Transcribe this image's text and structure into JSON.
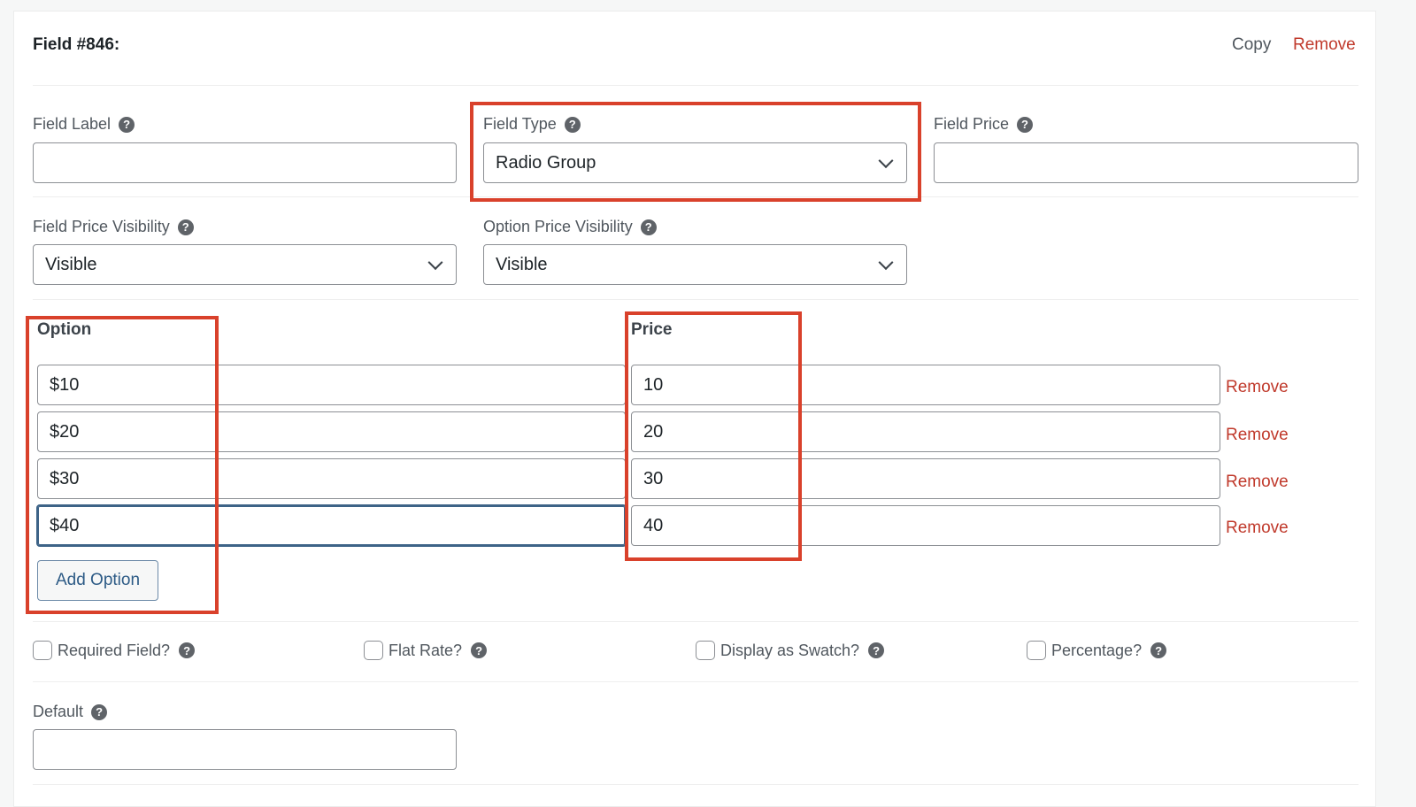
{
  "header": {
    "title": "Field #846:",
    "copy_label": "Copy",
    "remove_label": "Remove"
  },
  "fields": {
    "field_label": {
      "label": "Field Label",
      "value": ""
    },
    "field_type": {
      "label": "Field Type",
      "value": "Radio Group"
    },
    "field_price": {
      "label": "Field Price",
      "value": ""
    },
    "field_price_visibility": {
      "label": "Field Price Visibility",
      "value": "Visible"
    },
    "option_price_visibility": {
      "label": "Option Price Visibility",
      "value": "Visible"
    }
  },
  "options": {
    "option_header": "Option",
    "price_header": "Price",
    "rows": [
      {
        "option": "$10",
        "price": "10",
        "remove_label": "Remove"
      },
      {
        "option": "$20",
        "price": "20",
        "remove_label": "Remove"
      },
      {
        "option": "$30",
        "price": "30",
        "remove_label": "Remove"
      },
      {
        "option": "$40",
        "price": "40",
        "remove_label": "Remove"
      }
    ],
    "add_option_label": "Add Option"
  },
  "checkboxes": [
    {
      "label": "Required Field?",
      "checked": false
    },
    {
      "label": "Flat Rate?",
      "checked": false
    },
    {
      "label": "Display as Swatch?",
      "checked": false
    },
    {
      "label": "Percentage?",
      "checked": false
    }
  ],
  "default_field": {
    "label": "Default",
    "value": ""
  },
  "help_glyph": "?",
  "colors": {
    "accent_remove": "#c0392b",
    "highlight_box": "#d9412b",
    "focus_border": "#3d6387",
    "button_text": "#2d5b86"
  }
}
